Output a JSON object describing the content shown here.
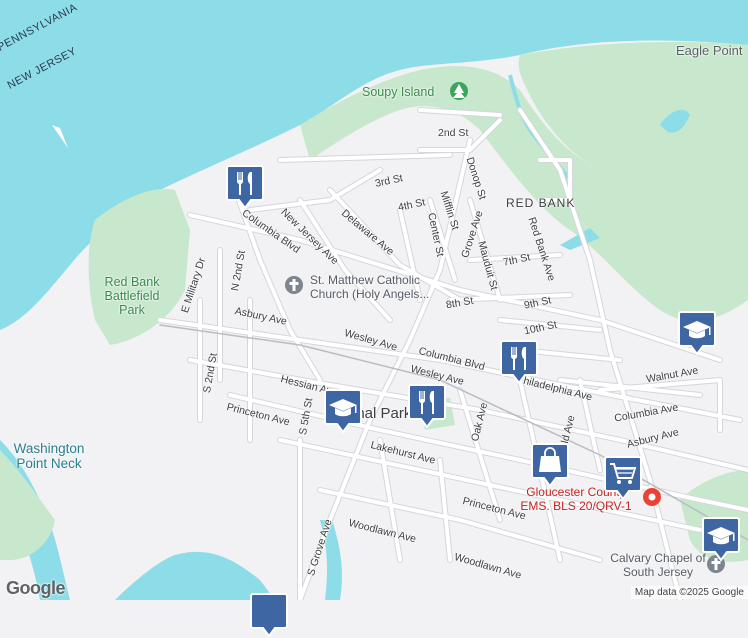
{
  "colors": {
    "water": "#8ddde9",
    "park": "#c7e8cc",
    "land": "#f2f1f3",
    "road": "#ffffff",
    "road_edge": "#d4d6da",
    "marker_fill": "#3e66a3"
  },
  "labels": {
    "state_pa": "PENNSYLVANIA",
    "state_nj": "NEW JERSEY",
    "soupy_island": "Soupy Island",
    "eagle_point": "Eagle Point",
    "red_bank": "RED BANK",
    "red_bank_battlefield": "Red Bank Battlefield Park",
    "washington_point": "Washington Point Neck",
    "national_park": "onal Park",
    "church": "St. Matthew Catholic Church (Holy Angels...",
    "gloucester_ems": "Gloucester County EMS. BLS 20/QRV-1",
    "calvary": "Calvary Chapel of South Jersey"
  },
  "streets": {
    "s2nd": "2nd St",
    "s3rd": "3rd St",
    "s4th": "4th St",
    "s7th": "7th St",
    "s8th": "8th St",
    "s9th": "9th St",
    "s10th": "10th St",
    "donop": "Donop St",
    "grove": "Grove Ave",
    "mifflin": "Mifflin St",
    "center": "Center St",
    "mauduit": "Mauduit St",
    "redbank_ave": "Red Bank Ave",
    "delaware": "Delaware Ave",
    "newjersey": "New Jersey Ave",
    "columbia1": "Columbia Blvd",
    "columbia2": "Columbia Blvd",
    "columbia_ave": "Columbia Ave",
    "military": "E Military Dr",
    "n2nd": "N 2nd St",
    "asbury": "Asbury Ave",
    "asbury2": "Asbury Ave",
    "wesley": "Wesley Ave",
    "wesley2": "Wesley Ave",
    "philadelphia": "Philadelphia Ave",
    "walnut": "Walnut Ave",
    "hessian": "Hessian Ave",
    "s2nd_s": "S 2nd St",
    "princeton": "Princeton Ave",
    "princeton2": "Princeton Ave",
    "s5th": "S 5th St",
    "lakehurst": "Lakehurst Ave",
    "oak": "Oak Ave",
    "oak2": "ld Ave",
    "woodlawn": "Woodlawn Ave",
    "woodlawn2": "Woodlawn Ave",
    "sgrove": "S Grove Ave"
  },
  "markers": [
    {
      "name": "restaurant-marker-columbia",
      "icon": "restaurant-icon"
    },
    {
      "name": "restaurant-marker-wesley",
      "icon": "restaurant-icon"
    },
    {
      "name": "restaurant-marker-national-park",
      "icon": "restaurant-icon"
    },
    {
      "name": "school-marker-hessian",
      "icon": "school-icon"
    },
    {
      "name": "school-marker-walnut",
      "icon": "school-icon"
    },
    {
      "name": "school-marker-right-edge",
      "icon": "school-icon"
    },
    {
      "name": "shopping-bag-marker",
      "icon": "shopping-bag-icon"
    },
    {
      "name": "shopping-cart-marker",
      "icon": "shopping-cart-icon"
    }
  ],
  "attribution": {
    "logo": "Google",
    "text": "Map data ©2025 Google"
  }
}
